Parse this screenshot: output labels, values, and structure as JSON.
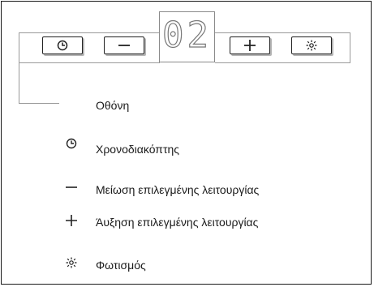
{
  "display": {
    "value": "02",
    "label": "Οθόνη"
  },
  "panel_buttons": [
    {
      "name": "timer-button",
      "icon": "clock-icon"
    },
    {
      "name": "minus-button",
      "icon": "minus-icon"
    },
    {
      "name": "plus-button",
      "icon": "plus-icon"
    },
    {
      "name": "light-button",
      "icon": "sun-icon"
    }
  ],
  "legend": [
    {
      "icon": "clock-icon",
      "label": "Χρονοδιακόπτης"
    },
    {
      "icon": "minus-icon",
      "label": "Μείωση επιλεγμένης λειτουργίας"
    },
    {
      "icon": "plus-icon",
      "label": "Άυξηση επιλεγμένης λειτουργίας"
    },
    {
      "icon": "sun-icon",
      "label": "Φωτισμός"
    }
  ]
}
